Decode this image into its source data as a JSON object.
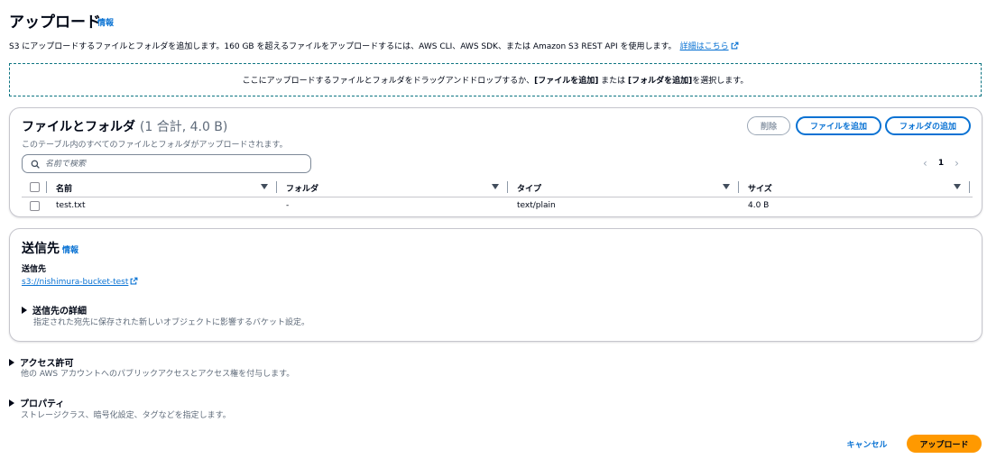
{
  "header": {
    "title": "アップロード",
    "info": "情報",
    "description": "S3 にアップロードするファイルとフォルダを追加します。160 GB を超えるファイルをアップロードするには、AWS CLI、AWS SDK、または Amazon S3 REST API を使用します。",
    "learn_more": "詳細はこちら"
  },
  "dropzone": {
    "text_before": "ここにアップロードするファイルとフォルダをドラッグアンドドロップするか、",
    "add_files": "[ファイルを追加]",
    "text_mid": " または ",
    "add_folder": "[フォルダを追加]",
    "text_after": " を選択します。"
  },
  "files": {
    "title": "ファイルとフォルダ",
    "count": "(1 合計, 4.0 B)",
    "description": "このテーブル内のすべてのファイルとフォルダがアップロードされます。",
    "delete_label": "削除",
    "add_files_label": "ファイルを追加",
    "add_folder_label": "フォルダの追加",
    "search_placeholder": "名前で検索",
    "page": "1",
    "columns": [
      "名前",
      "フォルダ",
      "タイプ",
      "サイズ"
    ],
    "rows": [
      {
        "name": "test.txt",
        "folder": "-",
        "type": "text/plain",
        "size": "4.0 B"
      }
    ]
  },
  "destination": {
    "title": "送信先",
    "info": "情報",
    "label": "送信先",
    "url": "s3://nishimura-bucket-test",
    "details_title": "送信先の詳細",
    "details_desc": "指定された宛先に保存された新しいオブジェクトに影響するバケット設定。"
  },
  "permissions": {
    "title": "アクセス許可",
    "desc": "他の AWS アカウントへのパブリックアクセスとアクセス権を付与します。"
  },
  "properties": {
    "title": "プロパティ",
    "desc": "ストレージクラス、暗号化設定、タグなどを指定します。"
  },
  "footer": {
    "cancel_label": "キャンセル",
    "upload_label": "アップロード"
  },
  "colors": {
    "link": "#0972d3",
    "primary": "#ff9900",
    "dropzone_border": "#0e7582"
  }
}
